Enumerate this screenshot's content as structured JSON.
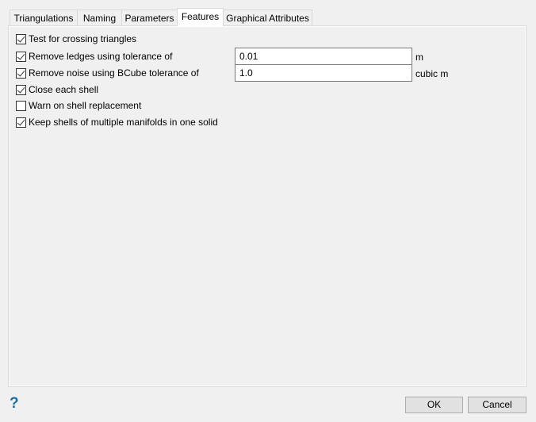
{
  "tabs": [
    {
      "label": "Triangulations"
    },
    {
      "label": "Naming"
    },
    {
      "label": "Parameters"
    },
    {
      "label": "Features",
      "selected": true
    },
    {
      "label": "Graphical Attributes"
    }
  ],
  "options": [
    {
      "label": "Test for crossing triangles",
      "checked": true
    },
    {
      "label": "Remove ledges using tolerance of",
      "checked": true,
      "value": "0.01",
      "unit": "m"
    },
    {
      "label": "Remove noise using BCube tolerance of",
      "checked": true,
      "value": "1.0",
      "unit": "cubic m"
    },
    {
      "label": "Close each shell",
      "checked": true
    },
    {
      "label": "Warn on shell replacement",
      "checked": false
    },
    {
      "label": "Keep shells of multiple manifolds in one solid",
      "checked": true
    }
  ],
  "buttons": {
    "ok": "OK",
    "cancel": "Cancel",
    "help": "?"
  }
}
